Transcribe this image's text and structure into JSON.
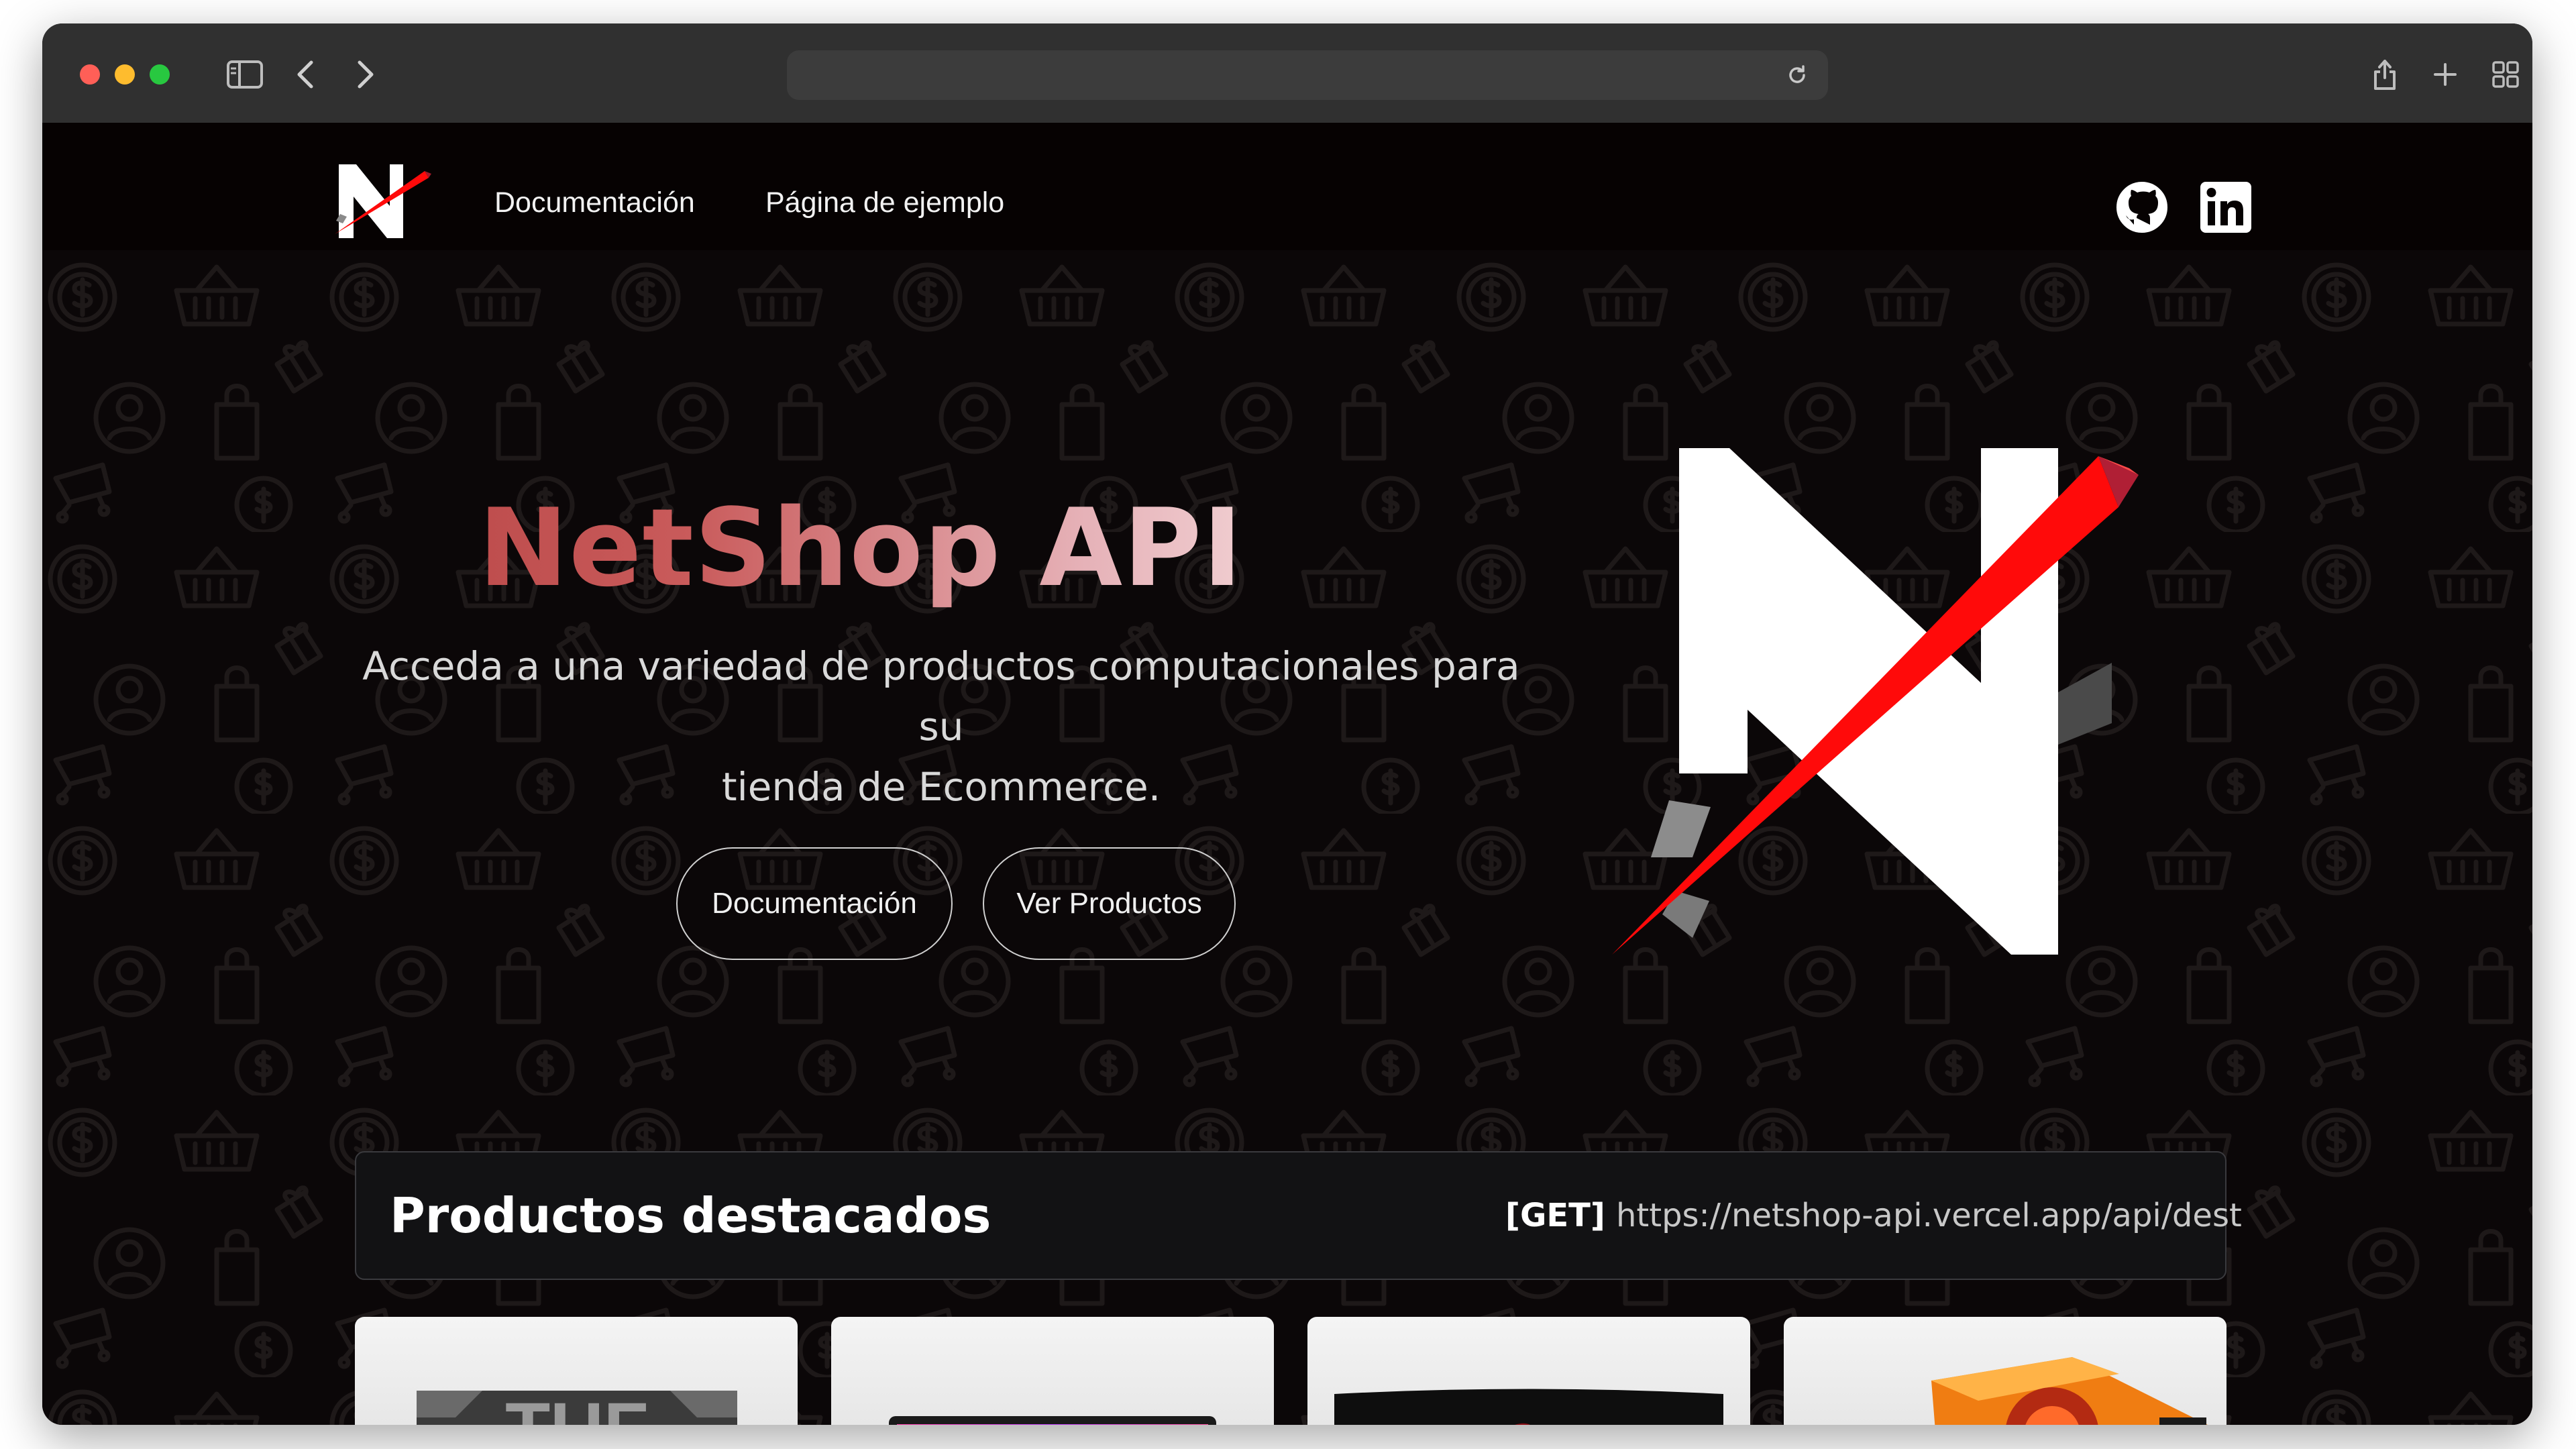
{
  "browser": {
    "traffic_lights": [
      "close",
      "minimize",
      "zoom"
    ],
    "icons": [
      "sidebar-toggle-icon",
      "back-icon",
      "forward-icon",
      "reload-icon",
      "share-icon",
      "new-tab-icon",
      "tab-overview-icon"
    ],
    "address_text": ""
  },
  "header": {
    "logo_letter": "N",
    "nav": [
      {
        "label": "Documentación"
      },
      {
        "label": "Página de ejemplo"
      }
    ],
    "social": [
      "github-icon",
      "linkedin-icon"
    ]
  },
  "hero": {
    "title": "NetShop API",
    "subtitle_line1": "Acceda a una variedad de productos computacionales para su",
    "subtitle_line2": "tienda de Ecommerce.",
    "buttons": [
      {
        "label": "Documentación"
      },
      {
        "label": "Ver Productos"
      }
    ]
  },
  "featured": {
    "title": "Productos destacados",
    "method": "[GET]",
    "endpoint": "https://netshop-api.vercel.app/api/dest",
    "products": [
      {
        "brand_text": "TUF",
        "kind": "motherboard"
      },
      {
        "kind": "laptop"
      },
      {
        "kind": "monitor"
      },
      {
        "kind": "cpu-box"
      }
    ]
  },
  "colors": {
    "accent_red": "#ff0a0a",
    "page_background": "#0b0708",
    "header_background": "#060202",
    "title_gradient": [
      "#b54242",
      "#fbeaea"
    ]
  }
}
